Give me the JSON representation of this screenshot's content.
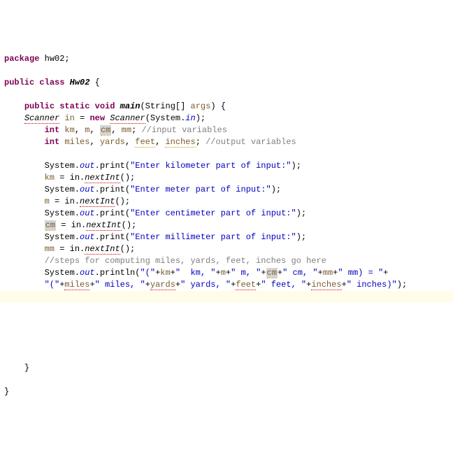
{
  "code": {
    "pkg_kw": "package",
    "pkg_name": "hw02",
    "semi": ";",
    "public": "public",
    "class_kw": "class",
    "class_name": "Hw02",
    "brace_open": "{",
    "brace_close": "}",
    "static": "static",
    "void": "void",
    "main": "main",
    "main_params_open": "(String[] ",
    "args": "args",
    "main_params_close": ") {",
    "scanner": "Scanner",
    "in_var": "in",
    "new_kw": "new",
    "sysin": "in",
    "paren_close_semi": ");",
    "int_kw": "int",
    "km": "km",
    "m": "m",
    "cm": "cm",
    "mm": "mm",
    "miles": "miles",
    "yards": "yards",
    "feet": "feet",
    "inches": "inches",
    "cmt_input": "//input variables",
    "cmt_output": "//output variables",
    "system": "System.",
    "out": "out",
    "print": ".print(",
    "println": ".println(",
    "str_km": "\"Enter kilometer part of input:\"",
    "str_m": "\"Enter meter part of input:\"",
    "str_cm": "\"Enter centimeter part of input:\"",
    "str_mm": "\"Enter millimeter part of input:\"",
    "eq_in": " = in.",
    "nextInt": "nextInt",
    "call_close": "();",
    "cmt_steps": "//steps for computing miles, yards, feet, inches go here",
    "p_open": "\"(\"",
    "plus": "+",
    "s_km": "\"  km, \"",
    "s_m": "\" m, \"",
    "s_cm": "\" cm, \"",
    "s_mm": "\" mm) = \"",
    "line2_open": "\"(\"",
    "s_miles": "\" miles, \"",
    "s_yards": "\" yards, \"",
    "s_feet": "\" feet, \"",
    "s_inches": "\" inches)\"",
    "comma_sp": ", ",
    "eq_sp": " = "
  }
}
